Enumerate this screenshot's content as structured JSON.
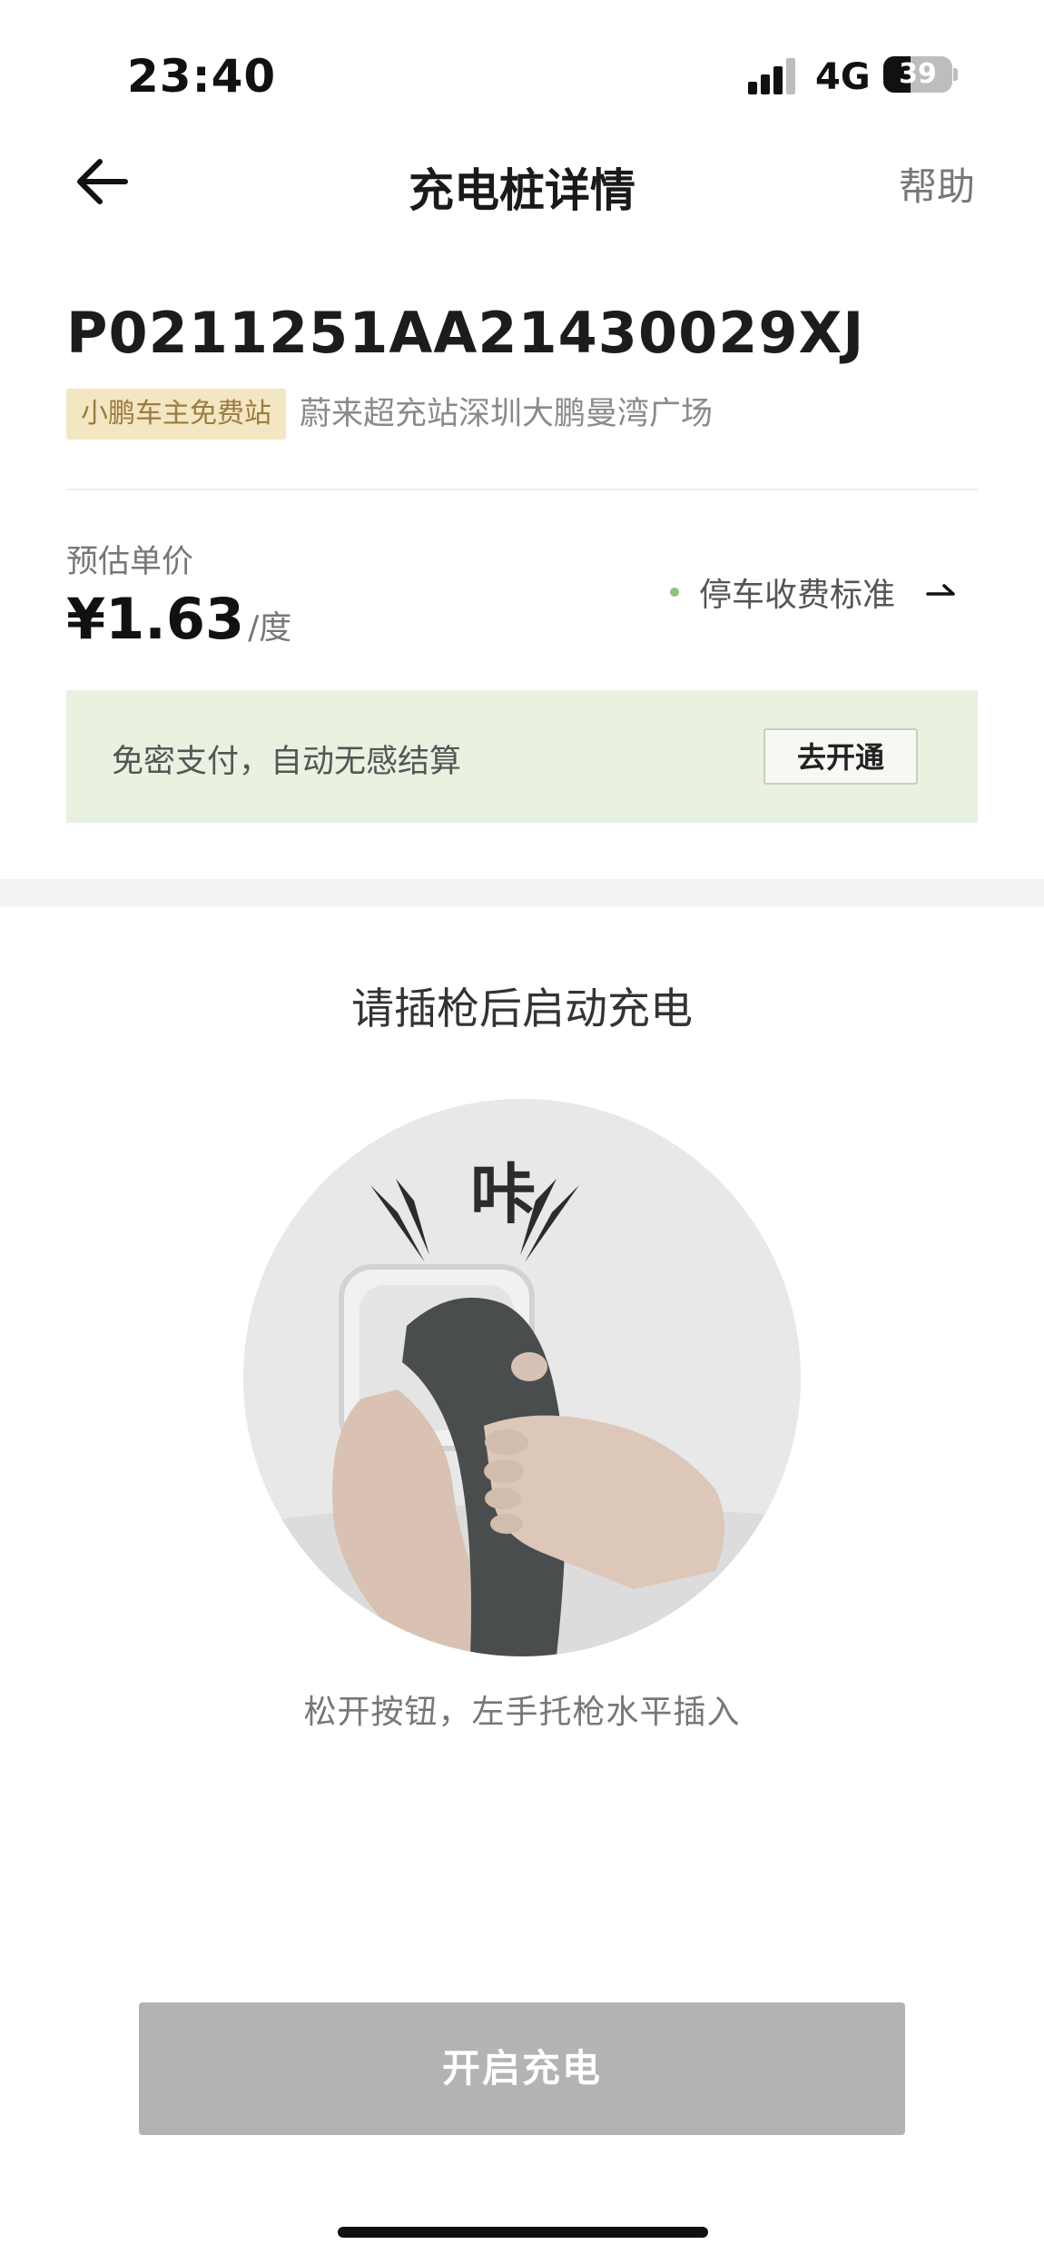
{
  "status_bar": {
    "time": "23:40",
    "network": "4G",
    "battery": "39",
    "battery_level": 0.39
  },
  "nav": {
    "title": "充电桩详情",
    "help": "帮助",
    "back_icon": "arrow-left-icon"
  },
  "charger": {
    "id": "P0211251AA21430029XJ",
    "tag": "小鹏车主免费站",
    "station": "蔚来超充站深圳大鹏曼湾广场"
  },
  "price": {
    "label": "预估单价",
    "value": "¥1.63",
    "unit": "/度",
    "parking_link": "停车收费标准",
    "parking_icon": "arrow-right-icon",
    "dot_color": "#8cc27a"
  },
  "promo": {
    "text": "免密支付，自动无感结算",
    "button": "去开通",
    "bg_color": "#e9f1e1"
  },
  "instruction": {
    "title": "请插枪后启动充电",
    "illustration_text": "咔",
    "subtitle": "松开按钮，左手托枪水平插入"
  },
  "action": {
    "start_label": "开启充电",
    "button_color": "#b3b3b3"
  }
}
